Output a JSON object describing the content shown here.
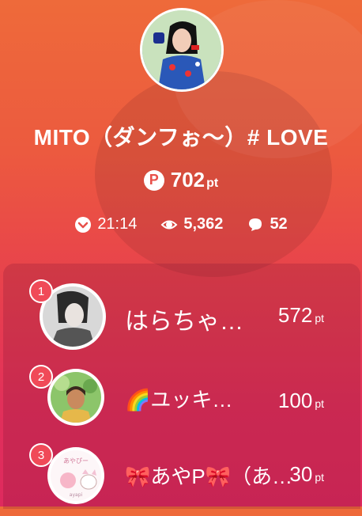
{
  "streamer": {
    "name": "MITO（ダンフぉ〜）# LOVE",
    "points": "702",
    "points_unit": "pt"
  },
  "stats": {
    "time": "21:14",
    "viewers": "5,362",
    "comments": "52"
  },
  "ranking": [
    {
      "rank": "1",
      "name": "はらちゃ…",
      "points": "572",
      "unit": "pt"
    },
    {
      "rank": "2",
      "name": "🌈ユッキ…",
      "points": "100",
      "unit": "pt"
    },
    {
      "rank": "3",
      "name": "🎀あやP🎀（あ…",
      "points": "30",
      "unit": "pt"
    }
  ],
  "icons": {
    "points": "p-coin-icon",
    "time": "clock-icon",
    "viewers": "eye-icon",
    "comments": "speech-bubble-icon"
  },
  "colors": {
    "accent": "#f04a58",
    "gradient_top": "#ee6a3a",
    "gradient_bottom": "#de2a5e"
  }
}
